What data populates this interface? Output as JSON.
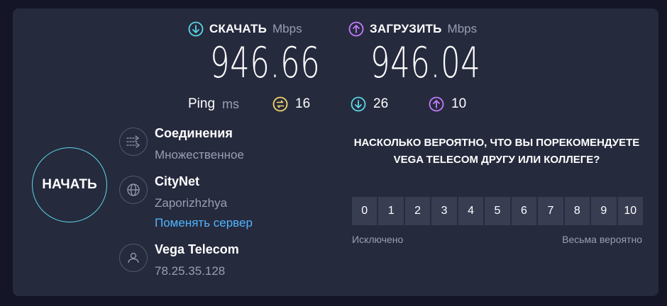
{
  "download": {
    "label": "СКАЧАТЬ",
    "unit": "Mbps",
    "value": "946.66",
    "icon": "arrow-down-circle-icon",
    "color": "#5ad7e5"
  },
  "upload": {
    "label": "ЗАГРУЗИТЬ",
    "unit": "Mbps",
    "value": "946.04",
    "icon": "arrow-up-circle-icon",
    "color": "#c27cff"
  },
  "ping": {
    "label": "Ping",
    "unit": "ms",
    "idle": "16",
    "download": "26",
    "upload": "10",
    "idle_color": "#f5d86b"
  },
  "start_button": "НАЧАТЬ",
  "connections": {
    "title": "Соединения",
    "value": "Множественное",
    "icon": "connections-icon"
  },
  "server": {
    "name": "CityNet",
    "location": "Zaporizhzhya",
    "change_link": "Поменять сервер",
    "icon": "globe-icon"
  },
  "provider": {
    "name": "Vega Telecom",
    "ip": "78.25.35.128",
    "icon": "user-icon"
  },
  "survey": {
    "question": "НАСКОЛЬКО ВЕРОЯТНО, ЧТО ВЫ ПОРЕКОМЕНДУЕТЕ VEGA TELECOM ДРУГУ ИЛИ КОЛЛЕГЕ?",
    "options": [
      "0",
      "1",
      "2",
      "3",
      "4",
      "5",
      "6",
      "7",
      "8",
      "9",
      "10"
    ],
    "low_label": "Исключено",
    "high_label": "Весьма вероятно"
  },
  "colors": {
    "background": "#141526",
    "panel": "#262a3d",
    "accent_link": "#4fb5ff"
  }
}
